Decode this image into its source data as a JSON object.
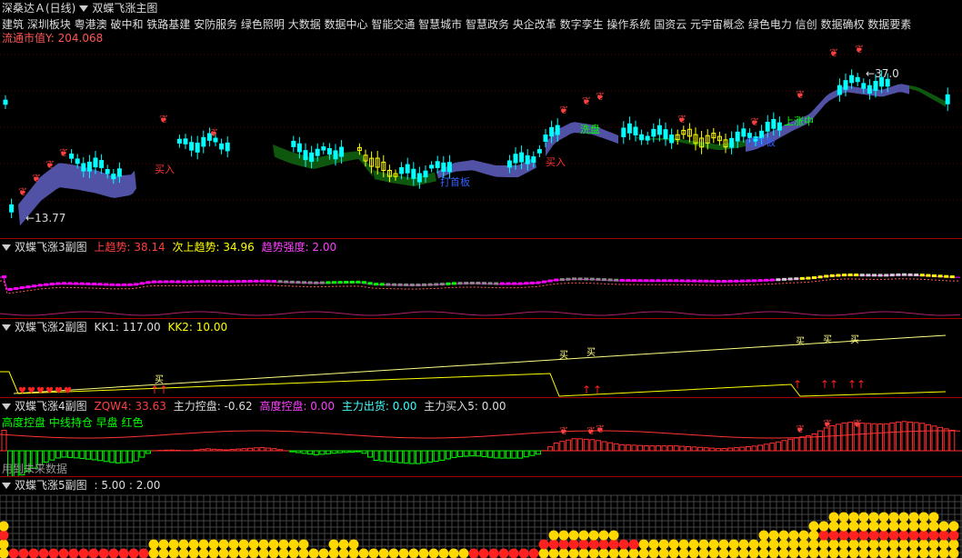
{
  "main": {
    "stock_name": "深桑达Ａ(日线)",
    "indicator": "双蝶飞涨主图",
    "concepts": "建筑 深圳板块 粤港澳 破中和 铁路基建 安防服务 绿色照明 大数据 数据中心 智能交通 智慧城市 智慧政务 央企改革 数字孪生 操作系统 国资云 元宇宙概念 绿色电力 信创 数据确权 数据要素",
    "float_cap": "流通市值Y:  204.068",
    "price_high": "37.0",
    "price_low": "13.77",
    "labels": [
      "买入",
      "买入",
      "洗盘",
      "打首板",
      "上涨中",
      "打首板"
    ]
  },
  "sub3": {
    "title": "双蝶飞涨3副图",
    "up_label": "上趋势: 38.14",
    "next_label": "次上趋势: 34.96",
    "strength_label": "趋势强度: 2.00"
  },
  "sub2": {
    "title": "双蝶飞涨2副图",
    "kk1": "KK1: 117.00",
    "kk2": "KK2: 10.00",
    "buy_text": "买"
  },
  "sub4": {
    "title": "双蝶飞涨4副图",
    "zqw4": "ZQW4: 33.63",
    "ctrl": "主力控盘: -0.62",
    "high_ctrl": "高度控盘: 0.00",
    "out": "主力出货: 0.00",
    "buy5": "主力买入5: 0.00",
    "future": "用到未来数据",
    "overlay": "高度控盘 中线持仓 早盘 红色"
  },
  "sub5": {
    "title": "双蝶飞涨5副图",
    "values": ": 5.00 : 2.00"
  },
  "colors": {
    "up": "#ff3333",
    "down": "#00ffff",
    "yellow": "#ffff00",
    "magenta": "#ff00ff",
    "green": "#00c000",
    "blue": "#5a5ab8"
  }
}
